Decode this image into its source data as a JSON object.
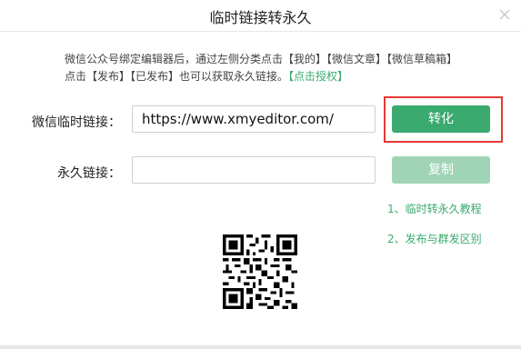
{
  "dialog": {
    "title": "临时链接转永久",
    "close_icon": "close-icon"
  },
  "description": {
    "line1": "微信公众号绑定编辑器后，通过左侧分类点击【我的】【微信文章】【微信草稿箱】",
    "line2_prefix": "点击【发布】【已发布】也可以获取永久链接。",
    "line2_link": "【点击授权】"
  },
  "form": {
    "temp_link_label": "微信临时链接：",
    "temp_link_value": "https://www.xmyeditor.com/",
    "convert_button": "转化",
    "permanent_link_label": "永久链接：",
    "permanent_link_value": "",
    "copy_button": "复制"
  },
  "help_links": [
    "1、临时转永久教程",
    "2、发布与群发区别"
  ],
  "colors": {
    "accent": "#3aaa6e",
    "accent_disabled": "#9fd5b6",
    "highlight_border": "#e53935"
  }
}
